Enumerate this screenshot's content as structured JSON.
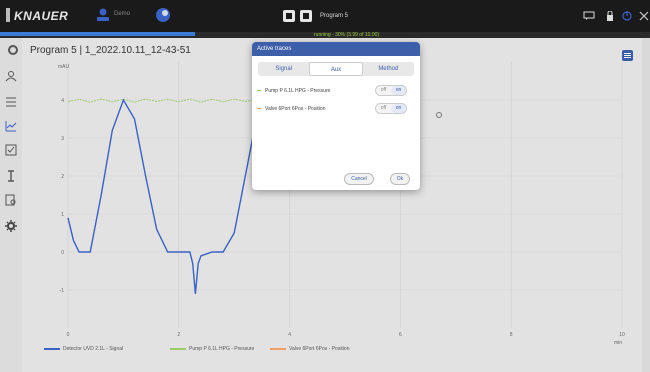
{
  "app": {
    "brand": "KNAUER",
    "user": "Demo",
    "program_name": "Program 5",
    "progress_text": "running - 30% (3.99 of 10.00)",
    "progress_fraction": 0.3
  },
  "panel": {
    "title": "Program 5 | 1_2022.10.11_12-43-51"
  },
  "dialog": {
    "title": "Active traces",
    "tabs": [
      {
        "label": "Signal",
        "active": false
      },
      {
        "label": "Aux",
        "active": true
      },
      {
        "label": "Method",
        "active": false
      }
    ],
    "traces": [
      {
        "label": "Pump P 6.1L HPG - Pressure",
        "off": "off",
        "on": "on",
        "color": "#9ccc65"
      },
      {
        "label": "Valve 6Port 6Pos - Position",
        "off": "off",
        "on": "on",
        "color": "#f0a060"
      }
    ],
    "cancel_label": "Cancel",
    "ok_label": "Ok"
  },
  "legend": [
    {
      "label": "Detector UVD 2.1L - Signal",
      "color": "#3a62c4"
    },
    {
      "label": "Pump P 6.1L HPG - Pressure",
      "color": "#9ccc65"
    },
    {
      "label": "Valve 6Port 6Pos - Position",
      "color": "#f0a060"
    }
  ],
  "chart_data": {
    "type": "line",
    "ylabel": "mAU",
    "xlabel": "min",
    "xlim": [
      0,
      10
    ],
    "ylim": [
      -2,
      5
    ],
    "x_ticks": [
      "0",
      "2",
      "4",
      "6",
      "8",
      "10"
    ],
    "y_ticks": [
      "-1",
      "0",
      "1",
      "2",
      "3",
      "4"
    ],
    "series": [
      {
        "name": "Detector UVD 2.1L - Signal",
        "color": "#3a62c4",
        "x": [
          0,
          0.1,
          0.2,
          0.3,
          0.4,
          0.6,
          0.8,
          1.0,
          1.2,
          1.4,
          1.6,
          1.8,
          1.9,
          2.0,
          2.1,
          2.2,
          2.25,
          2.3,
          2.35,
          2.4,
          2.6,
          2.8,
          3.0,
          3.2,
          3.4,
          3.5,
          3.55,
          3.6,
          3.65,
          3.7,
          3.76
        ],
        "y": [
          0.9,
          0.3,
          0.0,
          0.0,
          0.0,
          1.5,
          3.2,
          4.0,
          3.5,
          2.0,
          0.6,
          0.0,
          0.0,
          0.0,
          0.0,
          0.0,
          -0.3,
          -1.1,
          -0.3,
          -0.1,
          0.0,
          0.0,
          0.5,
          2.0,
          3.5,
          4.0,
          4.05,
          4.02,
          3.9,
          3.9,
          3.9
        ]
      },
      {
        "name": "Pump P 6.1L HPG - Pressure",
        "color": "#9ccc65",
        "x": [
          0,
          0.2,
          0.4,
          0.6,
          0.8,
          1.0,
          1.2,
          1.4,
          1.6,
          1.8,
          2.0,
          2.2,
          2.4,
          2.6,
          2.8,
          3.0,
          3.2,
          3.4,
          3.6
        ],
        "y": [
          3.95,
          4.02,
          3.94,
          4.03,
          3.95,
          4.02,
          3.94,
          4.03,
          3.96,
          4.02,
          3.95,
          4.03,
          3.94,
          4.02,
          3.95,
          4.02,
          3.96,
          4.01,
          3.95
        ]
      }
    ],
    "grid": true
  }
}
